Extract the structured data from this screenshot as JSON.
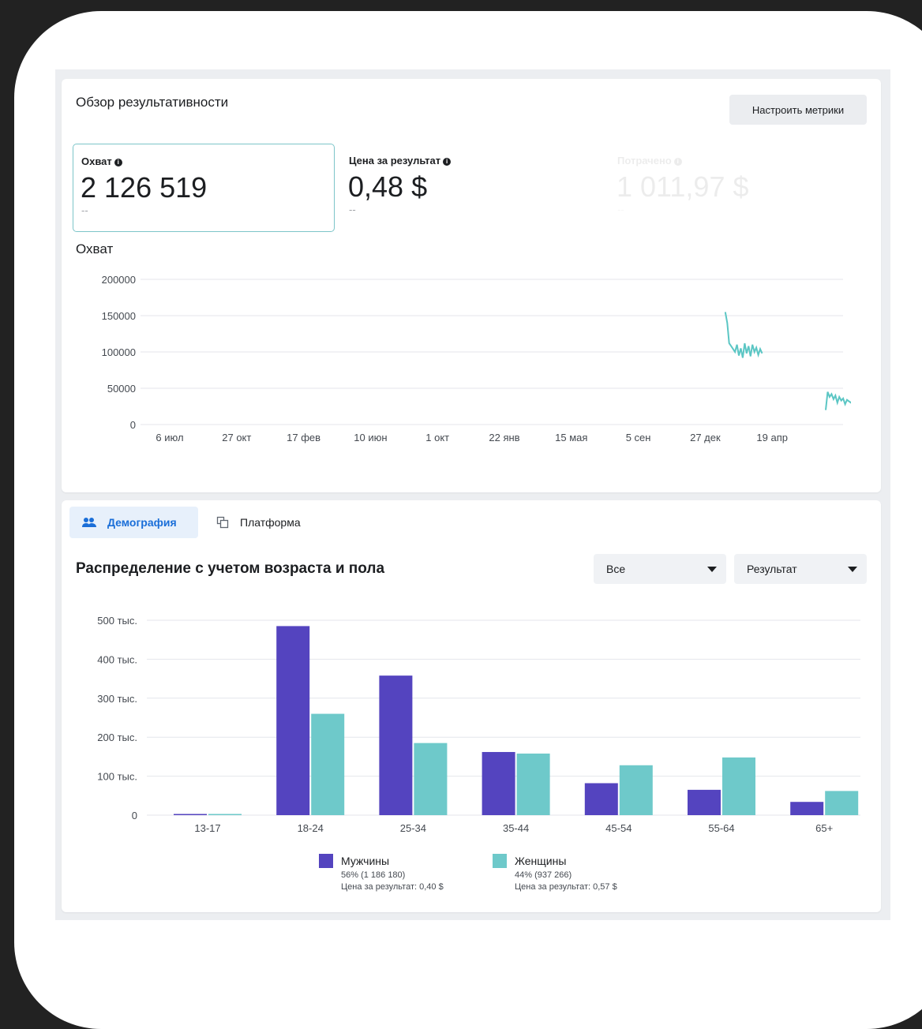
{
  "overview": {
    "title": "Обзор результативности",
    "configure_button": "Настроить метрики",
    "metrics": [
      {
        "label": "Охват",
        "value": "2 126 519",
        "delta": "--"
      },
      {
        "label": "Цена за результат",
        "value": "0,48 $",
        "delta": "--"
      },
      {
        "label": "Потрачено",
        "value": "1 011,97 $",
        "delta": "--"
      }
    ]
  },
  "line_chart_data": {
    "type": "line",
    "title": "Охват",
    "y_ticks": [
      "200000",
      "150000",
      "100000",
      "50000",
      "0"
    ],
    "x_ticks": [
      "6 июл",
      "27 окт",
      "17 фев",
      "10 июн",
      "1 окт",
      "22 янв",
      "15 мая",
      "5 сен",
      "27 дек",
      "19 апр"
    ],
    "ylim": [
      0,
      200000
    ],
    "segments": [
      {
        "x_start_tick": 8.3,
        "x_end_tick": 8.85,
        "values": [
          155000,
          140000,
          112000,
          108000,
          104000,
          100000,
          110000,
          95000,
          105000,
          92000,
          112000,
          98000,
          108000,
          94000,
          110000,
          100000,
          106000,
          96000,
          104000,
          98000
        ]
      },
      {
        "x_start_tick": 9.8,
        "x_end_tick": 10.35,
        "values": [
          20000,
          45000,
          38000,
          42000,
          35000,
          40000,
          30000,
          38000,
          33000,
          36000,
          28000,
          34000,
          32000,
          30000,
          35000,
          28000,
          31000,
          29000,
          26000,
          30000
        ]
      }
    ],
    "color": "#5bc6c4",
    "grid": true
  },
  "tabs": [
    {
      "label": "Демография",
      "icon": "people-icon",
      "active": true
    },
    {
      "label": "Платформа",
      "icon": "platform-icon",
      "active": false
    }
  ],
  "demographics": {
    "title": "Распределение с учетом возраста и пола",
    "filter_all": "Все",
    "filter_metric": "Результат"
  },
  "chart_data": {
    "type": "bar",
    "categories": [
      "13-17",
      "18-24",
      "25-34",
      "35-44",
      "45-54",
      "55-64",
      "65+"
    ],
    "y_ticks": [
      "500 тыс.",
      "400 тыс.",
      "300 тыс.",
      "200 тыс.",
      "100 тыс.",
      "0"
    ],
    "ylim": [
      0,
      500000
    ],
    "series": [
      {
        "name": "Мужчины",
        "color": "#5444bf",
        "values": [
          2000,
          485000,
          358000,
          162000,
          82000,
          65000,
          34000
        ]
      },
      {
        "name": "Женщины",
        "color": "#6ec9ca",
        "values": [
          1500,
          260000,
          185000,
          158000,
          128000,
          148000,
          62000
        ]
      }
    ],
    "legend": [
      {
        "name": "Мужчины",
        "share": "56% (1 186 180)",
        "cost": "Цена за результат: 0,40 $"
      },
      {
        "name": "Женщины",
        "share": "44% (937 266)",
        "cost": "Цена за результат: 0,57 $"
      }
    ],
    "grid": true
  }
}
